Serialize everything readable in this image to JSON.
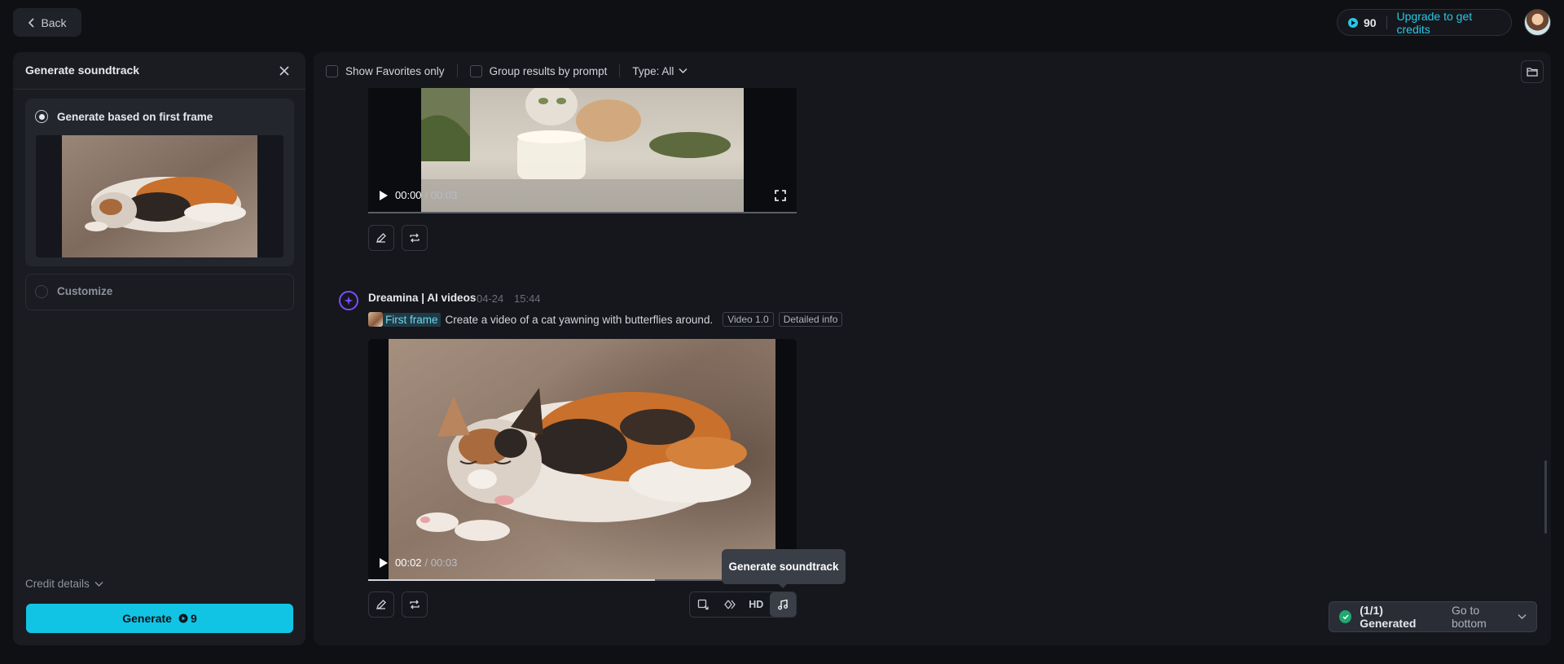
{
  "header": {
    "back_label": "Back",
    "credits": "90",
    "upgrade_label": "Upgrade to get credits"
  },
  "soundtrack_panel": {
    "title": "Generate soundtrack",
    "option_first_frame": "Generate based on first frame",
    "option_customize": "Customize",
    "credit_details": "Credit details",
    "generate_label": "Generate",
    "generate_cost": "9"
  },
  "filters": {
    "show_favorites": "Show Favorites only",
    "group_by_prompt": "Group results by prompt",
    "type_label": "Type: All"
  },
  "video1": {
    "current_time": "00:00",
    "duration": "/ 00:03"
  },
  "result": {
    "author": "Dreamina | AI videos",
    "date": "04-24",
    "time": "15:44",
    "first_frame_label": "First frame",
    "prompt": "Create a video of a cat yawning with butterflies around.",
    "tag_model": "Video 1.0",
    "tag_info": "Detailed info"
  },
  "video2": {
    "current_time": "00:02",
    "duration": "/ 00:03",
    "progress": 0.67
  },
  "toolbar": {
    "hd_label": "HD",
    "tooltip": "Generate soundtrack"
  },
  "toast": {
    "generated": "(1/1) Generated",
    "go_to_bottom": "Go to bottom"
  },
  "colors": {
    "accent": "#12c4e4",
    "link": "#28c7e8",
    "panel": "#1a1c22",
    "background": "#0f1014"
  }
}
